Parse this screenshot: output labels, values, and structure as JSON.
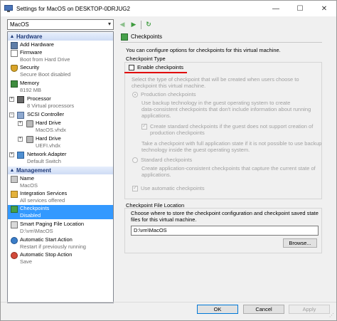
{
  "window": {
    "title": "Settings for MacOS on DESKTOP-0DRJUG2",
    "minimize_glyph": "—",
    "maximize_glyph": "☐",
    "close_glyph": "✕"
  },
  "vm_selector": {
    "value": "MacOS"
  },
  "toolbar": {
    "back_glyph": "◀",
    "forward_glyph": "▶",
    "refresh_glyph": "↻"
  },
  "sidebar": {
    "hardware_header": "Hardware",
    "management_header": "Management",
    "hardware_items": [
      {
        "label": "Add Hardware",
        "sub": "",
        "icon": "add-hardware-icon"
      },
      {
        "label": "Firmware",
        "sub": "Boot from Hard Drive",
        "icon": "firmware-icon"
      },
      {
        "label": "Security",
        "sub": "Secure Boot disabled",
        "icon": "security-shield-icon"
      },
      {
        "label": "Memory",
        "sub": "8192 MB",
        "icon": "memory-icon"
      },
      {
        "label": "Processor",
        "sub": "8 Virtual processors",
        "icon": "processor-icon"
      },
      {
        "label": "SCSI Controller",
        "sub": "",
        "icon": "scsi-controller-icon"
      },
      {
        "label": "Hard Drive",
        "sub": "MacOS.vhdx",
        "icon": "hard-drive-icon"
      },
      {
        "label": "Hard Drive",
        "sub": "UEFI.vhdx",
        "icon": "hard-drive-icon"
      },
      {
        "label": "Network Adapter",
        "sub": "Default Switch",
        "icon": "network-adapter-icon"
      }
    ],
    "management_items": [
      {
        "label": "Name",
        "sub": "MacOS",
        "icon": "name-icon"
      },
      {
        "label": "Integration Services",
        "sub": "All services offered",
        "icon": "integration-services-icon"
      },
      {
        "label": "Checkpoints",
        "sub": "Disabled",
        "icon": "checkpoints-icon"
      },
      {
        "label": "Smart Paging File Location",
        "sub": "D:\\vm\\MacOS",
        "icon": "smart-paging-icon"
      },
      {
        "label": "Automatic Start Action",
        "sub": "Restart if previously running",
        "icon": "auto-start-icon"
      },
      {
        "label": "Automatic Stop Action",
        "sub": "Save",
        "icon": "auto-stop-icon"
      }
    ]
  },
  "panel": {
    "title": "Checkpoints",
    "description": "You can configure options for checkpoints for this virtual machine.",
    "checkpoint_type": {
      "title": "Checkpoint Type",
      "enable_label": "Enable checkpoints",
      "enable_checked": false,
      "select_text": [
        "Select the type of checkpoint that will be created when users choose to",
        "checkpoint this virtual machine."
      ],
      "production_label": "Production checkpoints",
      "production_selected": true,
      "production_desc": [
        "Use backup technology in the guest operating system to create",
        "data-consistent checkpoints that don't include information about running",
        "applications."
      ],
      "create_standard_label": [
        "Create standard checkpoints if the guest does not support creation of",
        "production checkpoints"
      ],
      "create_standard_checked": true,
      "application_text": [
        "Take a checkpoint with full application state if it is not possible to use backup",
        "technology inside the guest operating system."
      ],
      "standard_label": "Standard checkpoints",
      "standard_selected": false,
      "standard_desc": [
        "Create application-consistent checkpoints that capture the current state of",
        "applications."
      ],
      "automatic_label": "Use automatic checkpoints",
      "automatic_checked": true
    },
    "file_location": {
      "title": "Checkpoint File Location",
      "desc": [
        "Choose where to store the checkpoint configuration and checkpoint saved state",
        "files for this virtual machine."
      ],
      "path": "D:\\vm\\MacOS",
      "browse_label": "Browse..."
    }
  },
  "footer": {
    "ok_label": "OK",
    "cancel_label": "Cancel",
    "apply_label": "Apply"
  },
  "colors": {
    "selection": "#3399ff",
    "header_text": "#1f3a78",
    "highlight_underline": "#e00000"
  }
}
